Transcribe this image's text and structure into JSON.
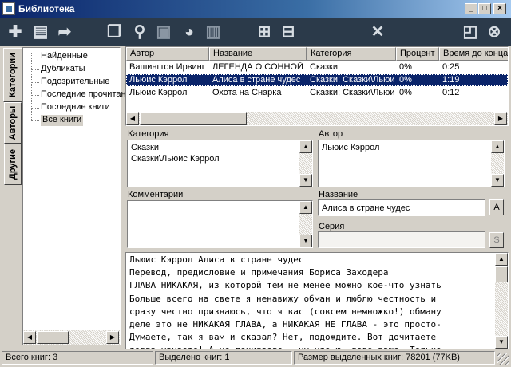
{
  "window": {
    "title": "Библиотека"
  },
  "toolbar": {
    "buttons": [
      {
        "name": "add-icon",
        "glyph": "✚"
      },
      {
        "name": "clipboard-icon",
        "glyph": "▤"
      },
      {
        "name": "forward-arrow-icon",
        "glyph": "➦"
      },
      {
        "name": "copy-icon",
        "glyph": "❐"
      },
      {
        "name": "search-icon",
        "glyph": "⚲"
      },
      {
        "name": "save-icon",
        "glyph": "▣"
      },
      {
        "name": "globe-icon",
        "glyph": "◕"
      },
      {
        "name": "columns-icon",
        "glyph": "▥"
      },
      {
        "name": "expand-icon",
        "glyph": "⊞"
      },
      {
        "name": "collapse-icon",
        "glyph": "⊟"
      },
      {
        "name": "close-x-icon",
        "glyph": "✕"
      },
      {
        "name": "restore-icon",
        "glyph": "◰"
      },
      {
        "name": "exit-icon",
        "glyph": "⊗"
      }
    ]
  },
  "side_tabs": [
    "Категории",
    "Авторы",
    "Другие"
  ],
  "tree": [
    "Найденные",
    "Дубликаты",
    "Подозрительные",
    "Последние прочитанные",
    "Последние книги",
    "Все книги"
  ],
  "tree_selected": 5,
  "grid": {
    "columns": [
      "Автор",
      "Название",
      "Категория",
      "Процент",
      "Время до конца"
    ],
    "rows": [
      {
        "author": "Вашингтон Ирвинг",
        "title": "ЛЕГЕНДА О СОННОЙ ЛОЩИНЕ",
        "category": "Сказки",
        "percent": "0%",
        "time": "0:25"
      },
      {
        "author": "Льюис Кэррол",
        "title": "Алиса в стране чудес",
        "category": "Сказки; Сказки\\Льюис Кэррол",
        "percent": "0%",
        "time": "1:19"
      },
      {
        "author": "Льюис Кэррол",
        "title": "Охота на Снарка",
        "category": "Сказки; Сказки\\Льюис Кэррол",
        "percent": "0%",
        "time": "0:12"
      }
    ],
    "selected_row": 1
  },
  "details": {
    "category_label": "Категория",
    "categories": [
      "Сказки",
      "Сказки\\Льюис Кэррол"
    ],
    "author_label": "Автор",
    "author": "Льюис Кэррол",
    "comments_label": "Комментарии",
    "comments": "",
    "title_label": "Название",
    "title": "Алиса в стране чудес",
    "title_btn": "A",
    "series_label": "Серия",
    "series": "",
    "series_btn": "S"
  },
  "preview": {
    "lines": [
      "Льюис Кэррол Алиса в стране чудес",
      "Перевод, предисловие и примечания Бориса Заходера",
      "ГЛАВА НИКАКАЯ, из которой тем не менее можно кое-что узнать",
      "Больше всего на свете я ненавижу обман и люблю честность и",
      "сразу честно признаюсь, что я вас (совсем немножко!) обману",
      "деле это не НИКАКАЯ ГЛАВА, а НИКАКАЯ НЕ ГЛАВА - это просто-",
      "Думаете, так я вам и сказал? Нет, подождите. Вот дочитаете",
      "тогда узнаете! А не дочитаете — ну что ж, дело ваше. Только"
    ]
  },
  "status": {
    "total": "Всего книг: 3",
    "selected": "Выделено книг: 1",
    "size": "Размер выделенных книг: 78201  (77KB)"
  },
  "colors": {
    "selection": "#0a246a",
    "toolbar_bg": "#2b3a4a",
    "window_bg": "#d4d0c8"
  }
}
